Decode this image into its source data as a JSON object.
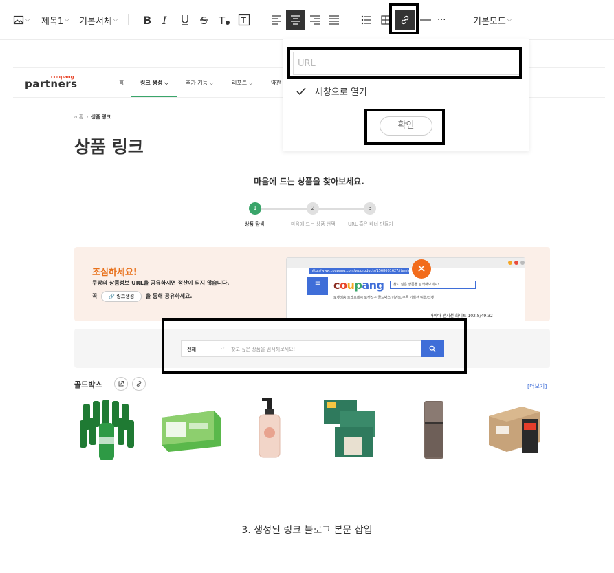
{
  "toolbar": {
    "heading": "제목1",
    "font": "기본서체",
    "mode": "기본모드",
    "more": "···"
  },
  "popup": {
    "url_placeholder": "URL",
    "new_window_label": "새창으로 열기",
    "new_window_checked": true,
    "confirm_label": "확인"
  },
  "screenshot": {
    "logo_small": "coupang",
    "logo": "partners",
    "nav": [
      "홈",
      "링크 생성",
      "추가 기능",
      "리포트",
      "약관"
    ],
    "breadcrumb_home": "홈",
    "breadcrumb_current": "상품 링크",
    "page_title": "상품 링크",
    "subtitle": "마음에 드는 상품을 찾아보세요.",
    "steps": [
      {
        "num": "1",
        "label": "상품 탐색"
      },
      {
        "num": "2",
        "label": "마음에 드는 상품 선택"
      },
      {
        "num": "3",
        "label": "URL 혹은 배너 만들기"
      }
    ],
    "caution_title": "조심하세요!",
    "caution_line1": "쿠팡의 상품정보 URL을 공유하시면 정산이 되지 않습니다.",
    "caution_line2_pre": "꼭",
    "caution_pill": "링크생성",
    "caution_line2_post": "을 통해 공유하세요.",
    "browser_url": "http://www.coupang.com/vp/products/1568661627/itemId",
    "browser_logo": "coupang",
    "browser_search": "찾고 싶은 상품을 검색해보세요!",
    "browser_cats": "로켓배송   로켓프레시   로켓직구   골드박스   이벤트/쿠폰   기획전   여행/티켓",
    "browser_product": "아이바 맨지천 화이트 102.8/49.32",
    "browser_price": "아이바 맨지천 화이트 102.8/49.32",
    "search_category": "전체",
    "search_placeholder": "찾고 싶은 상품을 검색해보세요!",
    "goldbox_title": "골드박스",
    "more_label": "[더보기]"
  },
  "caption": "3. 생성된 링크 블로그 본문 삽입",
  "colors": {
    "accent_green": "#3aa56a",
    "accent_blue": "#3f6ed8",
    "caution_orange": "#e8701a"
  }
}
